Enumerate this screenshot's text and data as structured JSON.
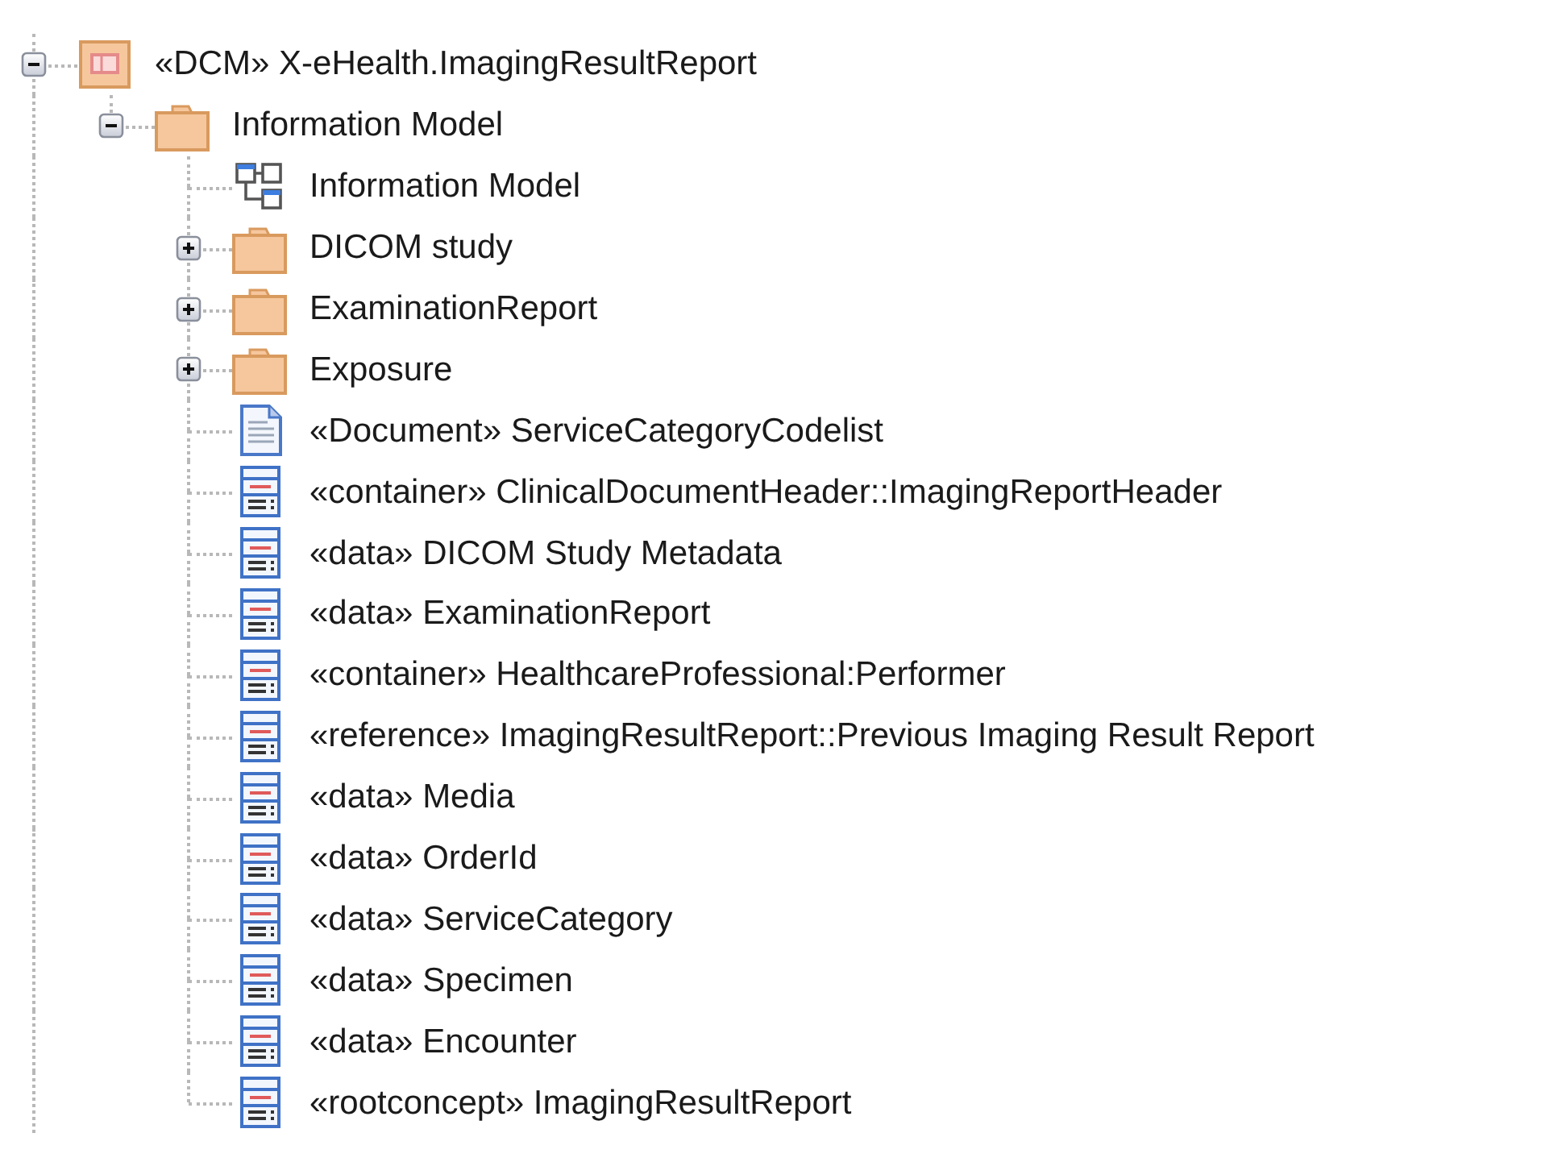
{
  "tree": [
    {
      "kind": "package",
      "label": "«DCM» X-eHealth.ImagingResultReport",
      "expanded": true,
      "children": [
        {
          "kind": "folder",
          "label": "Information Model",
          "expanded": true,
          "children": [
            {
              "kind": "diagram",
              "label": "Information Model"
            },
            {
              "kind": "folder",
              "label": "DICOM study",
              "expanded": false
            },
            {
              "kind": "folder",
              "label": "ExaminationReport",
              "expanded": false
            },
            {
              "kind": "folder",
              "label": "Exposure",
              "expanded": false
            },
            {
              "kind": "document",
              "label": "«Document» ServiceCategoryCodelist"
            },
            {
              "kind": "class",
              "label": "«container» ClinicalDocumentHeader::ImagingReportHeader"
            },
            {
              "kind": "class",
              "label": "«data» DICOM Study Metadata"
            },
            {
              "kind": "class",
              "label": "«data» ExaminationReport"
            },
            {
              "kind": "class",
              "label": "«container» HealthcareProfessional:Performer"
            },
            {
              "kind": "class",
              "label": "«reference» ImagingResultReport::Previous Imaging Result Report"
            },
            {
              "kind": "class",
              "label": "«data» Media"
            },
            {
              "kind": "class",
              "label": "«data» OrderId"
            },
            {
              "kind": "class",
              "label": "«data» ServiceCategory"
            },
            {
              "kind": "class",
              "label": "«data» Specimen"
            },
            {
              "kind": "class",
              "label": "«data» Encounter"
            },
            {
              "kind": "class",
              "label": "«rootconcept» ImagingResultReport"
            }
          ]
        }
      ]
    }
  ]
}
